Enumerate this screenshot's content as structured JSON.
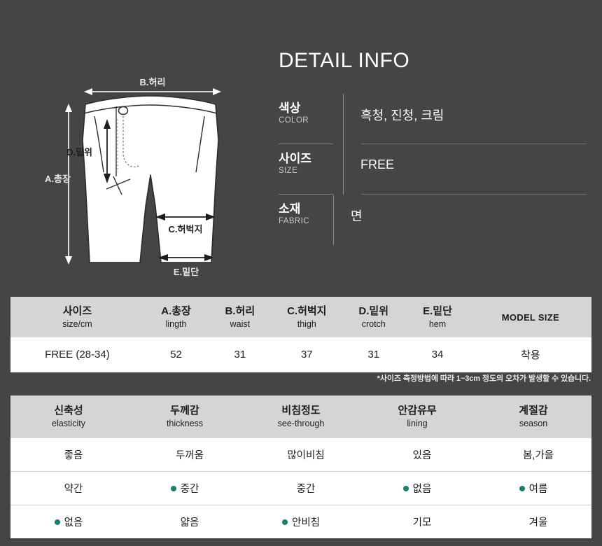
{
  "detail": {
    "title": "DETAIL INFO",
    "specs": [
      {
        "key_kr": "색상",
        "key_en": "COLOR",
        "value": "흑청, 진청, 크림"
      },
      {
        "key_kr": "사이즈",
        "key_en": "SIZE",
        "value": "FREE"
      },
      {
        "key_kr": "소재",
        "key_en": "FABRIC",
        "value": "면"
      }
    ]
  },
  "diagram": {
    "labels": {
      "total_length": "A.총장",
      "waist": "B.허리",
      "thigh": "C.허벅지",
      "crotch": "D.밑위",
      "hem": "E.밑단"
    }
  },
  "size_table": {
    "headers": [
      {
        "kr": "사이즈",
        "en": "size/cm"
      },
      {
        "kr": "A.총장",
        "en": "lingth"
      },
      {
        "kr": "B.허리",
        "en": "waist"
      },
      {
        "kr": "C.허벅지",
        "en": "thigh"
      },
      {
        "kr": "D.밑위",
        "en": "crotch"
      },
      {
        "kr": "E.밑단",
        "en": "hem"
      },
      {
        "kr": "MODEL SIZE",
        "en": ""
      }
    ],
    "rows": [
      [
        "FREE (28-34)",
        "52",
        "31",
        "37",
        "31",
        "34",
        "착용"
      ]
    ],
    "note": "*사이즈 측정방법에 따라 1~3cm 정도의 오차가 발생할 수 있습니다."
  },
  "attr_table": {
    "headers": [
      {
        "kr": "신축성",
        "en": "elasticity"
      },
      {
        "kr": "두께감",
        "en": "thickness"
      },
      {
        "kr": "비침정도",
        "en": "see-through"
      },
      {
        "kr": "안감유무",
        "en": "lining"
      },
      {
        "kr": "계절감",
        "en": "season"
      }
    ],
    "rows": [
      [
        {
          "text": "좋음",
          "selected": false
        },
        {
          "text": "두꺼움",
          "selected": false
        },
        {
          "text": "많이비침",
          "selected": false
        },
        {
          "text": "있음",
          "selected": false
        },
        {
          "text": "봄,가을",
          "selected": false
        }
      ],
      [
        {
          "text": "약간",
          "selected": false
        },
        {
          "text": "중간",
          "selected": true
        },
        {
          "text": "중간",
          "selected": false
        },
        {
          "text": "없음",
          "selected": true
        },
        {
          "text": "여름",
          "selected": true
        }
      ],
      [
        {
          "text": "없음",
          "selected": true
        },
        {
          "text": "얇음",
          "selected": false
        },
        {
          "text": "안비침",
          "selected": true
        },
        {
          "text": "기모",
          "selected": false
        },
        {
          "text": "겨울",
          "selected": false
        }
      ]
    ],
    "selected_color": "#1a7f6b"
  },
  "theme": {
    "background": "#454545",
    "header_gray": "#d5d5d5",
    "cell_white": "#ffffff"
  }
}
